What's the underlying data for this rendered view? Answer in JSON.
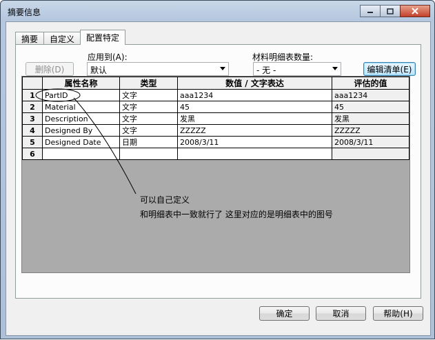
{
  "window": {
    "title": "摘要信息",
    "controls": {
      "minimize": "minimize-icon",
      "maximize": "maximize-icon",
      "close": "close-icon"
    }
  },
  "tabs": [
    {
      "label": "摘要",
      "active": false
    },
    {
      "label": "自定义",
      "active": false
    },
    {
      "label": "配置特定",
      "active": true
    }
  ],
  "toolbar": {
    "delete_label": "删除(D)",
    "apply_to_label": "应用到(A):",
    "apply_to_value": "默认",
    "bom_qty_label": "材料明细表数量:",
    "bom_qty_value": "- 无 -",
    "edit_list_label": "编辑清单(E)"
  },
  "table": {
    "columns": [
      "属性名称",
      "类型",
      "数值 / 文字表达",
      "评估的值"
    ],
    "rows": [
      {
        "num": "1",
        "name": "PartID",
        "type": "文字",
        "value": "aaa1234",
        "evaluated": "aaa1234"
      },
      {
        "num": "2",
        "name": "Material",
        "type": "文字",
        "value": "45",
        "evaluated": "45"
      },
      {
        "num": "3",
        "name": "Description",
        "type": "文字",
        "value": "发黑",
        "evaluated": "发黑"
      },
      {
        "num": "4",
        "name": "Designed By",
        "type": "文字",
        "value": "ZZZZZ",
        "evaluated": "ZZZZZ"
      },
      {
        "num": "5",
        "name": "Designed Date",
        "type": "日期",
        "value": "2008/3/11",
        "evaluated": "2008/3/11"
      },
      {
        "num": "6",
        "name": "",
        "type": "",
        "value": "",
        "evaluated": ""
      }
    ]
  },
  "annotation": {
    "line1": "可以自己定义",
    "line2": "和明细表中一致就行了 这里对应的是明细表中的图号"
  },
  "footer": {
    "ok_label": "确定",
    "cancel_label": "取消",
    "help_label": "帮助(H)"
  },
  "colors": {
    "focus_border": "#3c7fb1",
    "close_button": "#c2412a",
    "grid_background": "#ababab"
  }
}
